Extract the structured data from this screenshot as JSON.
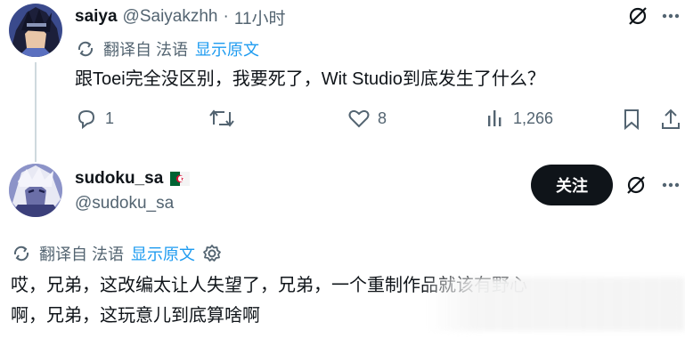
{
  "tweet1": {
    "display_name": "saiya",
    "handle": "@Saiyakzhh",
    "separator": "·",
    "time": "11小时",
    "translated_from": "翻译自 法语",
    "show_original": "显示原文",
    "text": "跟Toei完全没区别，我要死了，Wit Studio到底发生了什么？",
    "replies": "1",
    "likes": "8",
    "views": "1,266"
  },
  "tweet2": {
    "display_name": "sudoku_sa",
    "handle": "@sudoku_sa",
    "follow_label": "关注",
    "translated_from": "翻译自 法语",
    "show_original": "显示原文",
    "text_line1": "哎，兄弟，这改编太让人失望了，兄弟，一个重制作品就该有野心",
    "text_line2": "啊，兄弟，这玩意儿到底算啥啊"
  },
  "colors": {
    "text_primary": "#0f1419",
    "text_secondary": "#536471",
    "link": "#1d9bf0",
    "follow_bg": "#0f1419"
  },
  "icons": [
    "grok-icon",
    "more-icon",
    "translate-icon",
    "reply-icon",
    "retweet-icon",
    "like-icon",
    "views-icon",
    "bookmark-icon",
    "share-icon",
    "settings-icon",
    "flag-icon"
  ]
}
